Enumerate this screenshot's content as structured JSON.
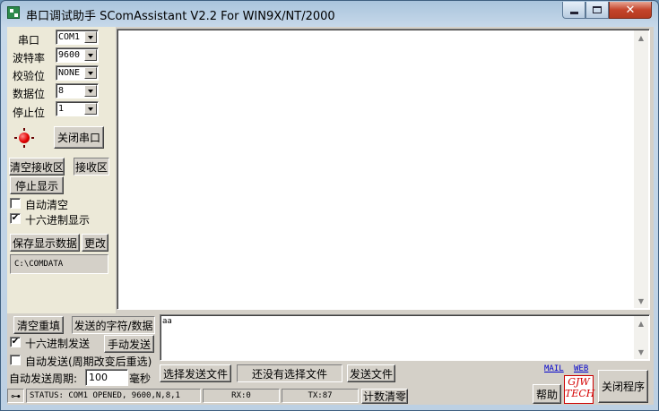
{
  "window": {
    "title": "串口调试助手 SComAssistant V2.2 For WIN9X/NT/2000",
    "min_glyph": "",
    "close_glyph": "✕"
  },
  "port_settings": {
    "port_label": "串口",
    "port_value": "COM1",
    "baud_label": "波特率",
    "baud_value": "9600",
    "parity_label": "校验位",
    "parity_value": "NONE",
    "databits_label": "数据位",
    "databits_value": "8",
    "stopbits_label": "停止位",
    "stopbits_value": "1",
    "close_port_button": "关闭串口",
    "status_led_color": "#e00000"
  },
  "receive": {
    "clear_button": "清空接收区",
    "area_label": "接收区",
    "stop_display_button": "停止显示",
    "auto_clear_label": "自动清空",
    "auto_clear_checked": false,
    "hex_display_label": "十六进制显示",
    "hex_display_checked": true,
    "save_button": "保存显示数据",
    "change_button": "更改",
    "save_path": "C:\\COMDATA",
    "content": ""
  },
  "send": {
    "clear_button": "清空重填",
    "area_label": "发送的字符/数据",
    "hex_send_label": "十六进制发送",
    "hex_send_checked": true,
    "manual_send_button": "手动发送",
    "auto_send_label": "自动发送(周期改变后重选)",
    "auto_send_checked": false,
    "period_label": "自动发送周期:",
    "period_value": "100",
    "period_unit": "毫秒",
    "content": "aa",
    "select_file_button": "选择发送文件",
    "file_status": "还没有选择文件",
    "send_file_button": "发送文件"
  },
  "status_bar": {
    "status_text": "STATUS: COM1 OPENED, 9600,N,8,1",
    "rx_text": "RX:0",
    "tx_text": "TX:87",
    "reset_count_button": "计数清零"
  },
  "footer": {
    "mail_link": "MAIL",
    "web_link": "WEB",
    "help_button": "帮助",
    "logo_line1": "GJW",
    "logo_line2": "TECH",
    "close_program_button": "关闭程序"
  }
}
